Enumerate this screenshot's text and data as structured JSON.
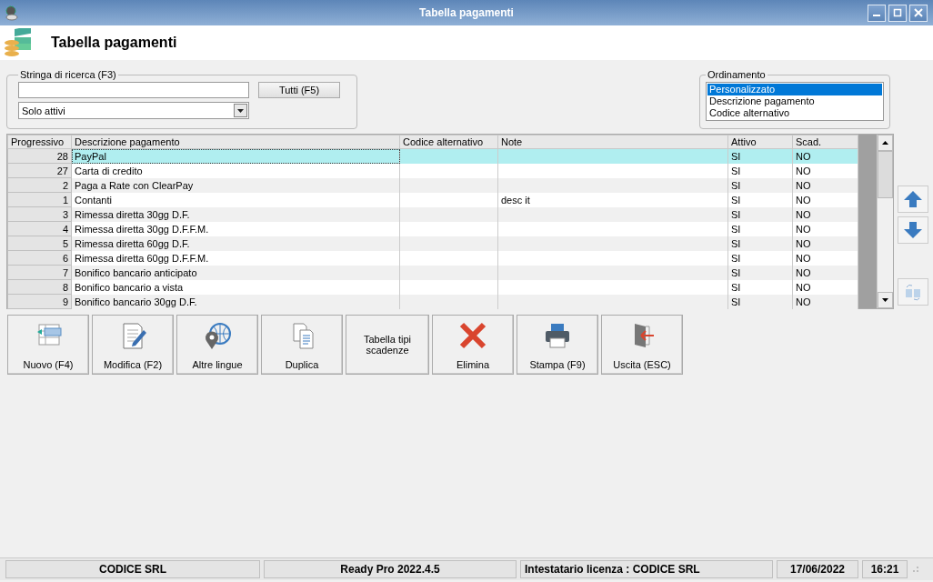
{
  "window": {
    "title": "Tabella pagamenti"
  },
  "header": {
    "title": "Tabella pagamenti"
  },
  "search": {
    "label": "Stringa di ricerca (F3)",
    "button": "Tutti (F5)",
    "filter": "Solo attivi"
  },
  "ordering": {
    "label": "Ordinamento",
    "options": [
      {
        "label": "Personalizzato",
        "selected": true
      },
      {
        "label": "Descrizione pagamento",
        "selected": false
      },
      {
        "label": "Codice alternativo",
        "selected": false
      }
    ]
  },
  "table": {
    "columns": [
      "Progressivo",
      "Descrizione pagamento",
      "Codice alternativo",
      "Note",
      "Attivo",
      "Scad."
    ],
    "rows": [
      {
        "cells": [
          "28",
          "PayPal",
          "",
          "",
          "SI",
          "NO"
        ],
        "selected": true
      },
      {
        "cells": [
          "27",
          "Carta di credito",
          "",
          "",
          "SI",
          "NO"
        ],
        "selected": false
      },
      {
        "cells": [
          "2",
          "Paga a Rate con ClearPay",
          "",
          "",
          "SI",
          "NO"
        ],
        "selected": false
      },
      {
        "cells": [
          "1",
          "Contanti",
          "",
          "desc it",
          "SI",
          "NO"
        ],
        "selected": false
      },
      {
        "cells": [
          "3",
          "Rimessa diretta 30gg D.F.",
          "",
          "",
          "SI",
          "NO"
        ],
        "selected": false
      },
      {
        "cells": [
          "4",
          "Rimessa diretta 30gg D.F.F.M.",
          "",
          "",
          "SI",
          "NO"
        ],
        "selected": false
      },
      {
        "cells": [
          "5",
          "Rimessa diretta 60gg D.F.",
          "",
          "",
          "SI",
          "NO"
        ],
        "selected": false
      },
      {
        "cells": [
          "6",
          "Rimessa diretta 60gg D.F.F.M.",
          "",
          "",
          "SI",
          "NO"
        ],
        "selected": false
      },
      {
        "cells": [
          "7",
          "Bonifico bancario anticipato",
          "",
          "",
          "SI",
          "NO"
        ],
        "selected": false
      },
      {
        "cells": [
          "8",
          "Bonifico bancario a vista",
          "",
          "",
          "SI",
          "NO"
        ],
        "selected": false
      },
      {
        "cells": [
          "9",
          "Bonifico bancario 30gg D.F.",
          "",
          "",
          "SI",
          "NO"
        ],
        "selected": false
      }
    ]
  },
  "toolbar": [
    {
      "label": "Nuovo (F4)",
      "kind": "new"
    },
    {
      "label": "Modifica (F2)",
      "kind": "edit"
    },
    {
      "label": "Altre lingue",
      "kind": "globe"
    },
    {
      "label": "Duplica",
      "kind": "copy"
    },
    {
      "label": "Tabella tipi scadenze",
      "kind": "text"
    },
    {
      "label": "Elimina",
      "kind": "delete"
    },
    {
      "label": "Stampa (F9)",
      "kind": "print"
    },
    {
      "label": "Uscita (ESC)",
      "kind": "exit"
    }
  ],
  "status_bar": [
    "CODICE SRL",
    "Ready Pro 2022.4.5",
    "Intestatario licenza : CODICE SRL",
    "17/06/2022",
    "16:21"
  ]
}
